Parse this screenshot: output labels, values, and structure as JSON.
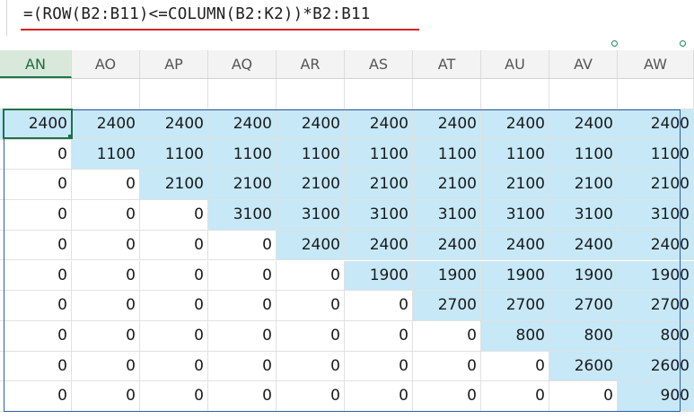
{
  "formula_bar": {
    "formula": "=(ROW(B2:B11)<=COLUMN(B2:K2))*B2:B11"
  },
  "columns": [
    "AN",
    "AO",
    "AP",
    "AQ",
    "AR",
    "AS",
    "AT",
    "AU",
    "AV",
    "AW"
  ],
  "active_column": "AN",
  "rows": [
    [
      "2400",
      "2400",
      "2400",
      "2400",
      "2400",
      "2400",
      "2400",
      "2400",
      "2400",
      "2400"
    ],
    [
      "0",
      "1100",
      "1100",
      "1100",
      "1100",
      "1100",
      "1100",
      "1100",
      "1100",
      "1100"
    ],
    [
      "0",
      "0",
      "2100",
      "2100",
      "2100",
      "2100",
      "2100",
      "2100",
      "2100",
      "2100"
    ],
    [
      "0",
      "0",
      "0",
      "3100",
      "3100",
      "3100",
      "3100",
      "3100",
      "3100",
      "3100"
    ],
    [
      "0",
      "0",
      "0",
      "0",
      "2400",
      "2400",
      "2400",
      "2400",
      "2400",
      "2400"
    ],
    [
      "0",
      "0",
      "0",
      "0",
      "0",
      "1900",
      "1900",
      "1900",
      "1900",
      "1900"
    ],
    [
      "0",
      "0",
      "0",
      "0",
      "0",
      "0",
      "2700",
      "2700",
      "2700",
      "2700"
    ],
    [
      "0",
      "0",
      "0",
      "0",
      "0",
      "0",
      "0",
      "800",
      "800",
      "800"
    ],
    [
      "0",
      "0",
      "0",
      "0",
      "0",
      "0",
      "0",
      "0",
      "2600",
      "2600"
    ],
    [
      "0",
      "0",
      "0",
      "0",
      "0",
      "0",
      "0",
      "0",
      "0",
      "900"
    ]
  ],
  "colors": {
    "highlight": "#c6e8f7",
    "selection_border": "#2f5fa8",
    "active_cell_border": "#1e7145",
    "formula_underline": "#d9201c"
  }
}
